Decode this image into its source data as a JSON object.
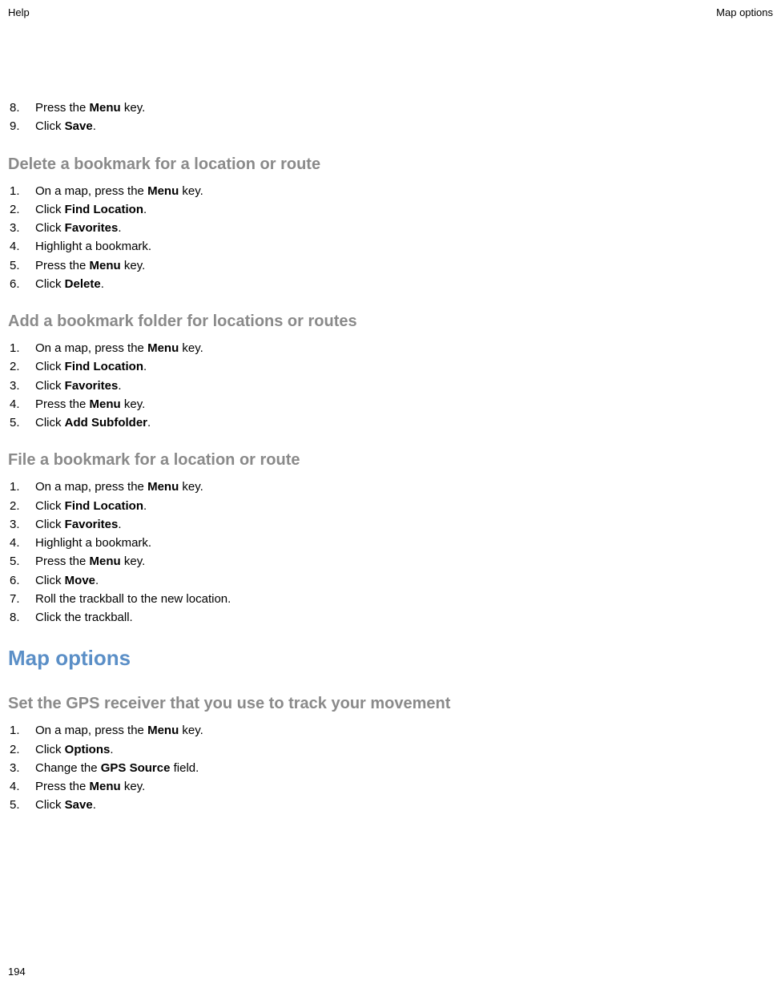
{
  "header": {
    "left": "Help",
    "right": "Map options"
  },
  "topList": {
    "items": [
      {
        "num": "8.",
        "prefix": "Press the ",
        "bold": "Menu",
        "suffix": " key."
      },
      {
        "num": "9.",
        "prefix": "Click ",
        "bold": "Save",
        "suffix": "."
      }
    ]
  },
  "section1": {
    "title": "Delete a bookmark for a location or route",
    "items": [
      {
        "num": "1.",
        "prefix": "On a map, press the ",
        "bold": "Menu",
        "suffix": " key."
      },
      {
        "num": "2.",
        "prefix": "Click ",
        "bold": "Find Location",
        "suffix": "."
      },
      {
        "num": "3.",
        "prefix": "Click ",
        "bold": "Favorites",
        "suffix": "."
      },
      {
        "num": "4.",
        "prefix": "Highlight a bookmark.",
        "bold": "",
        "suffix": ""
      },
      {
        "num": "5.",
        "prefix": "Press the ",
        "bold": "Menu",
        "suffix": " key."
      },
      {
        "num": "6.",
        "prefix": "Click ",
        "bold": "Delete",
        "suffix": "."
      }
    ]
  },
  "section2": {
    "title": "Add a bookmark folder for locations or routes",
    "items": [
      {
        "num": "1.",
        "prefix": "On a map, press the ",
        "bold": "Menu",
        "suffix": " key."
      },
      {
        "num": "2.",
        "prefix": "Click ",
        "bold": "Find Location",
        "suffix": "."
      },
      {
        "num": "3.",
        "prefix": "Click ",
        "bold": "Favorites",
        "suffix": "."
      },
      {
        "num": "4.",
        "prefix": "Press the ",
        "bold": "Menu",
        "suffix": " key."
      },
      {
        "num": "5.",
        "prefix": "Click ",
        "bold": "Add Subfolder",
        "suffix": "."
      }
    ]
  },
  "section3": {
    "title": "File a bookmark for a location or route",
    "items": [
      {
        "num": "1.",
        "prefix": "On a map, press the ",
        "bold": "Menu",
        "suffix": " key."
      },
      {
        "num": "2.",
        "prefix": "Click ",
        "bold": "Find Location",
        "suffix": "."
      },
      {
        "num": "3.",
        "prefix": "Click ",
        "bold": "Favorites",
        "suffix": "."
      },
      {
        "num": "4.",
        "prefix": "Highlight a bookmark.",
        "bold": "",
        "suffix": ""
      },
      {
        "num": "5.",
        "prefix": "Press the ",
        "bold": "Menu",
        "suffix": " key."
      },
      {
        "num": "6.",
        "prefix": "Click ",
        "bold": "Move",
        "suffix": "."
      },
      {
        "num": "7.",
        "prefix": "Roll the trackball to the new location.",
        "bold": "",
        "suffix": ""
      },
      {
        "num": "8.",
        "prefix": "Click the trackball.",
        "bold": "",
        "suffix": ""
      }
    ]
  },
  "mainHeading": "Map options",
  "section4": {
    "title": "Set the GPS receiver that you use to track your movement",
    "items": [
      {
        "num": "1.",
        "prefix": "On a map, press the ",
        "bold": "Menu",
        "suffix": " key."
      },
      {
        "num": "2.",
        "prefix": "Click ",
        "bold": "Options",
        "suffix": "."
      },
      {
        "num": "3.",
        "prefix": "Change the ",
        "bold": "GPS Source",
        "suffix": " field."
      },
      {
        "num": "4.",
        "prefix": "Press the ",
        "bold": "Menu",
        "suffix": " key."
      },
      {
        "num": "5.",
        "prefix": "Click ",
        "bold": "Save",
        "suffix": "."
      }
    ]
  },
  "pageNumber": "194"
}
